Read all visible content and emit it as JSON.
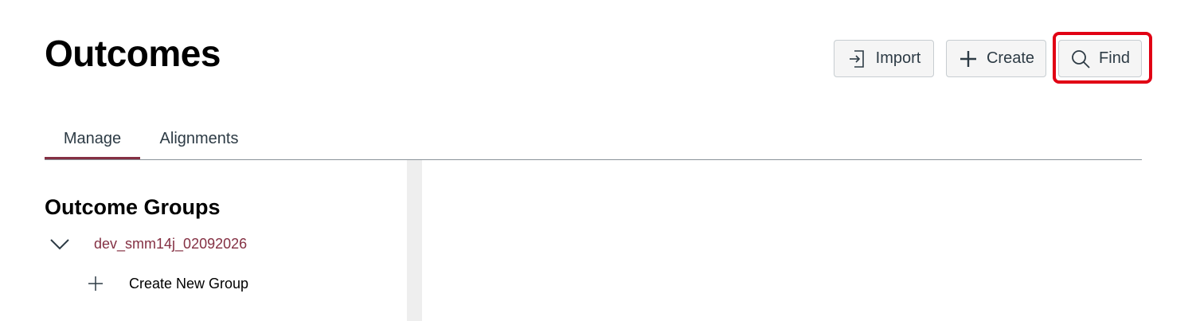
{
  "header": {
    "title": "Outcomes",
    "buttons": {
      "import_label": "Import",
      "create_label": "Create",
      "find_label": "Find"
    }
  },
  "tabs": [
    {
      "label": "Manage",
      "selected": true
    },
    {
      "label": "Alignments",
      "selected": false
    }
  ],
  "sidebar": {
    "heading": "Outcome Groups",
    "group": {
      "name": "dev_smm14j_02092026",
      "expanded": true
    },
    "create_new_group_label": "Create New Group"
  },
  "icons": {
    "import": "import-icon",
    "create": "plus-icon",
    "find": "search-icon",
    "collapse": "chevron-down-icon",
    "new_group": "plus-icon"
  },
  "colors": {
    "brand": "#843043",
    "highlight": "#e10014",
    "button_bg": "#f5f5f5"
  }
}
